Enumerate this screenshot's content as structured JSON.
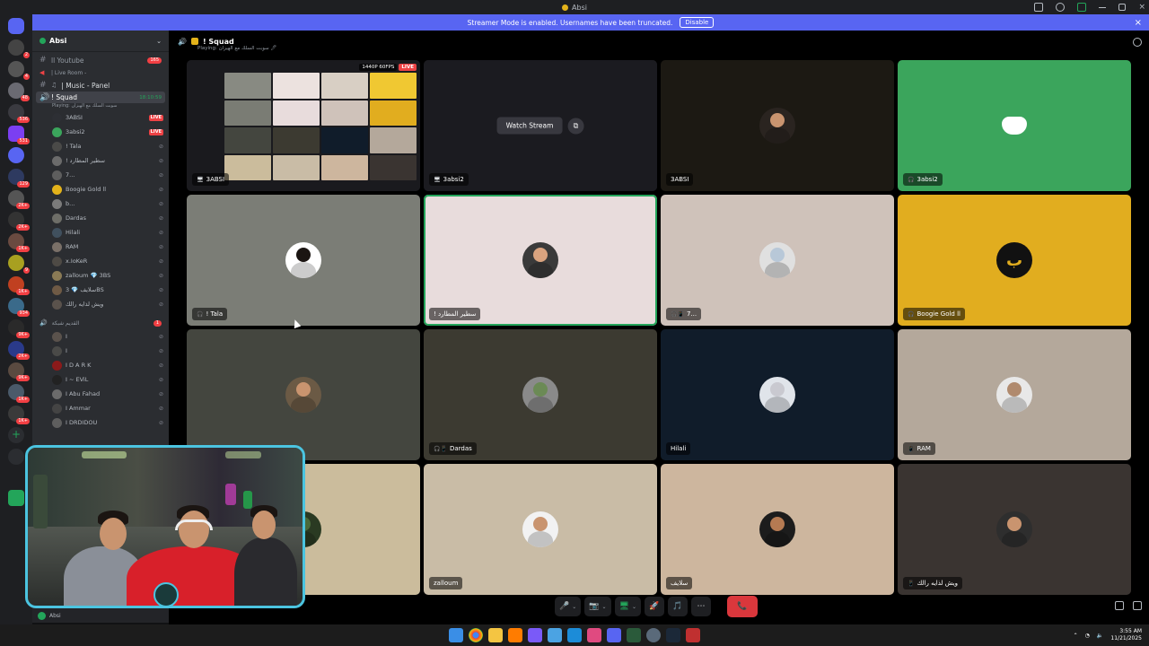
{
  "window": {
    "title": "Absi"
  },
  "banner": {
    "text": "Streamer Mode is enabled. Usernames have been truncated.",
    "action": "Disable"
  },
  "server": {
    "name": "Absi"
  },
  "channels": [
    {
      "name": "ll Youtube",
      "count": "165"
    },
    {
      "name": "| Live Room -",
      "count": ""
    },
    {
      "name": "| Music - Panel",
      "count": ""
    }
  ],
  "active_channel": {
    "name": "! Squad",
    "time": "18:10:59",
    "sub": "Playing: سوبت السلك مع الهيزان"
  },
  "members": [
    {
      "name": "3ABSI",
      "live": "LIVE",
      "color": "#2d2f34"
    },
    {
      "name": "3absi2",
      "live": "LIVE",
      "color": "#3ba55c"
    },
    {
      "name": "! Tala",
      "live": "",
      "color": "#4a4a48"
    },
    {
      "name": "! سطير المطارد",
      "live": "",
      "color": "#6b6b6b"
    },
    {
      "name": "7...",
      "live": "",
      "color": "#5e5e5e"
    },
    {
      "name": "Boogie Gold ll",
      "live": "",
      "color": "#e3b21a"
    },
    {
      "name": "b...",
      "live": "",
      "color": "#7b7b7b"
    },
    {
      "name": "Dardas",
      "live": "",
      "color": "#6e6e68"
    },
    {
      "name": "Hilali",
      "live": "",
      "color": "#40505e"
    },
    {
      "name": "RAM",
      "live": "",
      "color": "#7a7068"
    },
    {
      "name": "x.IoKeR",
      "live": "",
      "color": "#4e4a45"
    },
    {
      "name": "zalloum 💎 3BS",
      "live": "",
      "color": "#8a7a55"
    },
    {
      "name": "سلايف 💎 3BS",
      "live": "",
      "color": "#6f5a45"
    },
    {
      "name": "ويش لذايه رالك",
      "live": "",
      "color": "#5a524c"
    }
  ],
  "category2": {
    "name": "القديم شبكة",
    "count": "1"
  },
  "members2": [
    {
      "name": "I",
      "color": "#5a524c"
    },
    {
      "name": "I",
      "color": "#4a4a48"
    },
    {
      "name": "I D A R K",
      "color": "#8b1a1a"
    },
    {
      "name": "I ~ EViL",
      "color": "#222"
    },
    {
      "name": "I Abu Fahad",
      "color": "#6b6b6b"
    },
    {
      "name": "I Ammar",
      "color": "#444"
    },
    {
      "name": "I DRDIDOU",
      "color": "#5e5e5e"
    }
  ],
  "footer_user": "Absi",
  "stage": {
    "title": "! Squad",
    "subtitle": "Playing: سوبت السلك مع الهيزان 🖊"
  },
  "stream": {
    "resolution": "1440P 60FPS",
    "live": "LIVE",
    "watch": "Watch Stream"
  },
  "tiles": [
    {
      "name": "3ABSI",
      "bg": "#1a1a1e",
      "type": "preview",
      "ic": "🖥"
    },
    {
      "name": "3absi2",
      "bg": "#1c1c20",
      "type": "watch",
      "ic": "🖥"
    },
    {
      "name": "3ABSI",
      "bg": "#1c1913",
      "type": "avatar",
      "ic": "",
      "skin": "#c9946f",
      "shirt": "#2a2420"
    },
    {
      "name": "3absi2",
      "bg": "#3ba55c",
      "type": "discord",
      "ic": "🎧"
    },
    {
      "name": "! Tala",
      "bg": "#7b7d76",
      "type": "avatar",
      "ic": "🎧",
      "skin": "#1b1512",
      "shirt": "#ffffff"
    },
    {
      "name": "! سطير المطارد",
      "bg": "#e8dcdc",
      "type": "avatar",
      "ic": "",
      "skin": "#d9a37f",
      "shirt": "#3a3a3a",
      "speaking": true
    },
    {
      "name": "7...",
      "bg": "#cfc2ba",
      "type": "avatar",
      "ic": "🎧📱",
      "skin": "#b8c8d8",
      "shirt": "#e0e0e0"
    },
    {
      "name": "Boogie Gold ll",
      "bg": "#e1ad1f",
      "type": "logo",
      "ic": "🎧"
    },
    {
      "name": "",
      "bg": "#44463f",
      "type": "avatar",
      "ic": "",
      "skin": "#c9946f",
      "shirt": "#6b5a45"
    },
    {
      "name": "Dardas",
      "bg": "#3c3a31",
      "type": "avatar",
      "ic": "🎧📱",
      "skin": "#6b8a55",
      "shirt": "#8a8a8a"
    },
    {
      "name": "Hilali",
      "bg": "#101c2a",
      "type": "avatar",
      "ic": "",
      "skin": "#c9c9d0",
      "shirt": "#e0e4ea"
    },
    {
      "name": "RAM",
      "bg": "#b4a89b",
      "type": "avatar",
      "ic": "📱",
      "skin": "#b08a6e",
      "shirt": "#e8e8e8"
    },
    {
      "name": "",
      "bg": "#cbbc9c",
      "type": "avatar",
      "ic": "",
      "skin": "#4a6a3a",
      "shirt": "#2a3a22"
    },
    {
      "name": "zalloum",
      "bg": "#c9bca6",
      "type": "avatar",
      "ic": "",
      "skin": "#c9946f",
      "shirt": "#f2f2f2"
    },
    {
      "name": "سلايف",
      "bg": "#cdb69e",
      "type": "avatar",
      "ic": "",
      "skin": "#b57a52",
      "shirt": "#1c1c1c"
    },
    {
      "name": "ويش لذايه رالك",
      "bg": "#3a3431",
      "type": "avatar",
      "ic": "📱",
      "skin": "#c9946f",
      "shirt": "#2e2e2e"
    }
  ],
  "controls": {
    "mic": "🎤",
    "cam": "📷",
    "share": "🖥",
    "activity": "🚀",
    "soundboard": "🎵",
    "more": "⋯",
    "end": "📞"
  },
  "taskbar": {
    "time": "3:55 AM",
    "date": "11/21/2025"
  },
  "colors": {
    "accent": "#5865f2",
    "live": "#ed4245",
    "speaking": "#23a55a",
    "end_call": "#da373c"
  }
}
